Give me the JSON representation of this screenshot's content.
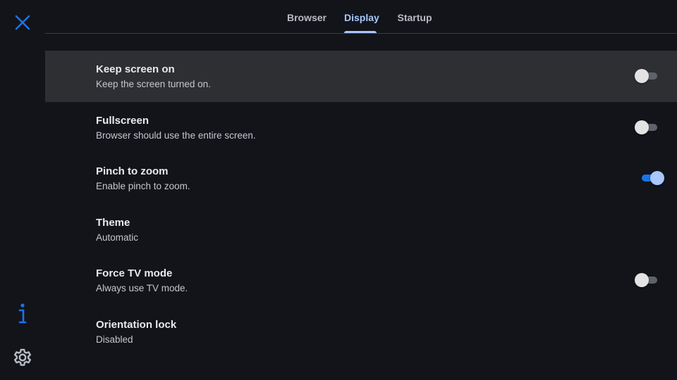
{
  "accent_color": "#a8c7fa",
  "rail": {
    "close_icon": "close-icon",
    "info_icon": "info-icon",
    "settings_icon": "gear-icon",
    "icon_color": "#1a73e8"
  },
  "tabs": [
    {
      "label": "Browser",
      "active": false
    },
    {
      "label": "Display",
      "active": true
    },
    {
      "label": "Startup",
      "active": false
    }
  ],
  "settings": [
    {
      "title": "Keep screen on",
      "subtitle": "Keep the screen turned on.",
      "toggle": false,
      "focused": true
    },
    {
      "title": "Fullscreen",
      "subtitle": "Browser should use the entire screen.",
      "toggle": false,
      "focused": false
    },
    {
      "title": "Pinch to zoom",
      "subtitle": "Enable pinch to zoom.",
      "toggle": true,
      "focused": false
    },
    {
      "title": "Theme",
      "subtitle": "Automatic",
      "toggle": null,
      "focused": false
    },
    {
      "title": "Force TV mode",
      "subtitle": "Always use TV mode.",
      "toggle": false,
      "focused": false
    },
    {
      "title": "Orientation lock",
      "subtitle": "Disabled",
      "toggle": null,
      "focused": false
    }
  ]
}
